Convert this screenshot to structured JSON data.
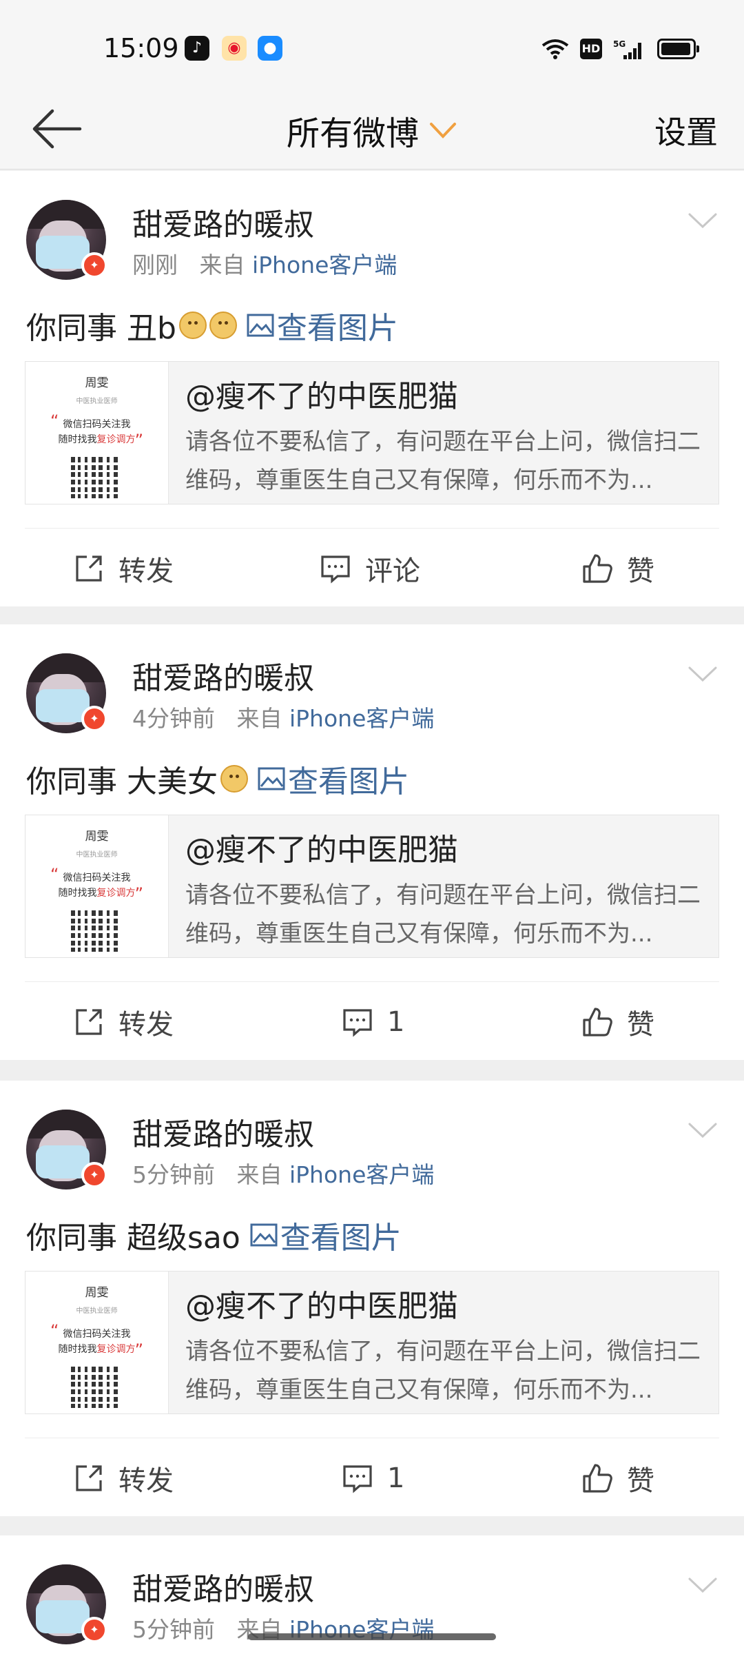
{
  "status_bar": {
    "time": "15:09",
    "app_icons": [
      "tiktok-icon",
      "weibo-icon",
      "qq-icon"
    ],
    "hd_label": "HD",
    "network_label": "5G"
  },
  "nav": {
    "title": "所有微博",
    "settings_label": "设置"
  },
  "colors": {
    "link_blue": "#416a9b",
    "accent_orange": "#f0a040",
    "badge_red": "#f0472e"
  },
  "posts": [
    {
      "username": "甜爱路的暖叔",
      "time": "刚刚",
      "via": "来自",
      "source": "iPhone客户端",
      "text": "你同事 丑b",
      "emoji_count": 2,
      "view_pic": "查看图片",
      "repost": {
        "author": "@瘦不了的中医肥猫",
        "body": "请各位不要私信了，有问题在平台上问，微信扫二维码，尊重医生自己又有保障，何乐而不为...",
        "thumb_name": "周雯",
        "thumb_sub": "中医执业医师",
        "thumb_line1": "微信扫码关注我",
        "thumb_line2_a": "随时找我",
        "thumb_line2_b": "复诊调方"
      },
      "actions": {
        "repost": "转发",
        "comment": "评论",
        "like": "赞"
      }
    },
    {
      "username": "甜爱路的暖叔",
      "time": "4分钟前",
      "via": "来自",
      "source": "iPhone客户端",
      "text": "你同事 大美女",
      "emoji_count": 1,
      "view_pic": "查看图片",
      "repost": {
        "author": "@瘦不了的中医肥猫",
        "body": "请各位不要私信了，有问题在平台上问，微信扫二维码，尊重医生自己又有保障，何乐而不为...",
        "thumb_name": "周雯",
        "thumb_sub": "中医执业医师",
        "thumb_line1": "微信扫码关注我",
        "thumb_line2_a": "随时找我",
        "thumb_line2_b": "复诊调方"
      },
      "actions": {
        "repost": "转发",
        "comment": "1",
        "like": "赞"
      }
    },
    {
      "username": "甜爱路的暖叔",
      "time": "5分钟前",
      "via": "来自",
      "source": "iPhone客户端",
      "text": "你同事 超级sao",
      "emoji_count": 0,
      "view_pic": "查看图片",
      "repost": {
        "author": "@瘦不了的中医肥猫",
        "body": "请各位不要私信了，有问题在平台上问，微信扫二维码，尊重医生自己又有保障，何乐而不为...",
        "thumb_name": "周雯",
        "thumb_sub": "中医执业医师",
        "thumb_line1": "微信扫码关注我",
        "thumb_line2_a": "随时找我",
        "thumb_line2_b": "复诊调方"
      },
      "actions": {
        "repost": "转发",
        "comment": "1",
        "like": "赞"
      }
    },
    {
      "username": "甜爱路的暖叔",
      "time": "5分钟前",
      "via": "来自",
      "source": "iPhone客户端"
    }
  ]
}
